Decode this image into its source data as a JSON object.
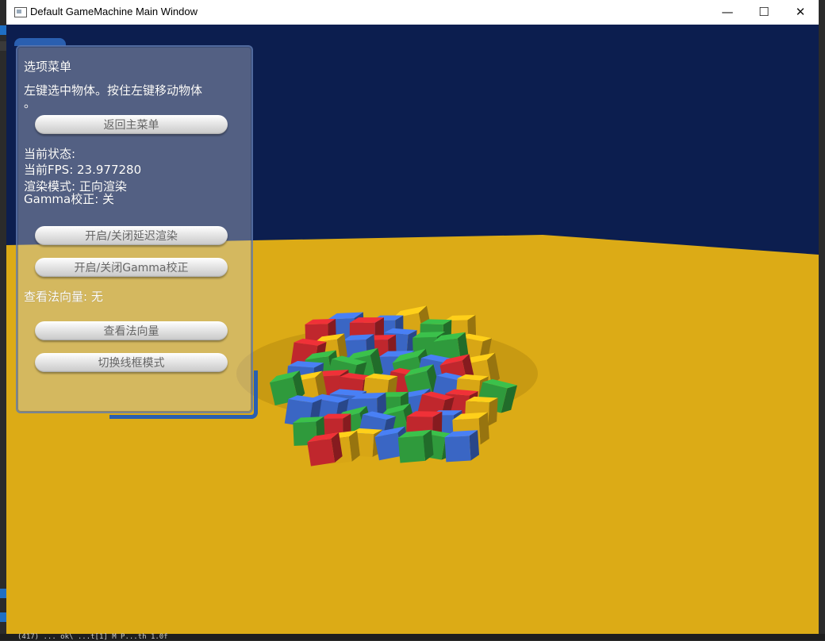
{
  "window": {
    "title": "Default GameMachine Main Window",
    "minimize_glyph": "—",
    "maximize_glyph": "☐",
    "close_glyph": "✕"
  },
  "menu": {
    "heading": "选项菜单",
    "hint_line1": "左键选中物体。按住左键移动物体",
    "hint_line2": "。",
    "back_button": "返回主菜单",
    "status_heading": "当前状态:",
    "fps": "当前FPS: 23.977280",
    "render_mode": "渲染模式: 正向渲染",
    "gamma": "Gamma校正: 关",
    "toggle_deferred_button": "开启/关闭延迟渲染",
    "toggle_gamma_button": "开启/关闭Gamma校正",
    "normal_status": "查看法向量: 无",
    "view_normals_button": "查看法向量",
    "wireframe_button": "切换线框模式"
  },
  "console_status_line": "(417) ... ok\\ ...t[1] M  P...th  1.0f",
  "colors": {
    "sky": "#0c1e4f",
    "floor": "#dcab16",
    "cube_red": "#c0272d",
    "cube_green": "#2f9a3c",
    "cube_blue": "#3a66c4",
    "cube_yellow": "#d8a615"
  }
}
